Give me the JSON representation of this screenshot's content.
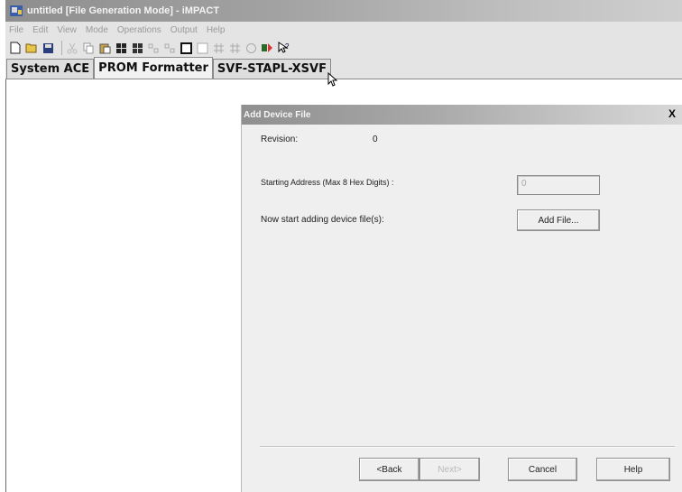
{
  "window": {
    "title": "untitled [File Generation Mode] - iMPACT"
  },
  "menubar": {
    "items": [
      "File",
      "Edit",
      "View",
      "Mode",
      "Operations",
      "Output",
      "Help"
    ]
  },
  "toolbar": {
    "icons": [
      "new-icon",
      "open-icon",
      "save-icon",
      "cut-icon",
      "copy-icon",
      "paste-icon",
      "grid-icon",
      "grid-icon-2",
      "chain-icon",
      "chain-icon-2",
      "box-icon",
      "box-icon-2",
      "grid-icon-3",
      "grid-icon-4",
      "circle-icon",
      "program-icon",
      "help-pointer-icon"
    ]
  },
  "tabs": [
    {
      "label": "System ACE"
    },
    {
      "label": "PROM Formatter"
    },
    {
      "label": "SVF-STAPL-XSVF"
    }
  ],
  "dialog": {
    "title": "Add Device File",
    "close_label": "X",
    "revision_label": "Revision:",
    "revision_value": "0",
    "start_addr_label": "Starting Address (Max 8 Hex Digits) :",
    "start_addr_value": "0",
    "adding_label": "Now start adding device file(s):",
    "add_file_button": "Add File...",
    "back_button": "<Back",
    "next_button": "Next>",
    "cancel_button": "Cancel",
    "help_button": "Help"
  }
}
